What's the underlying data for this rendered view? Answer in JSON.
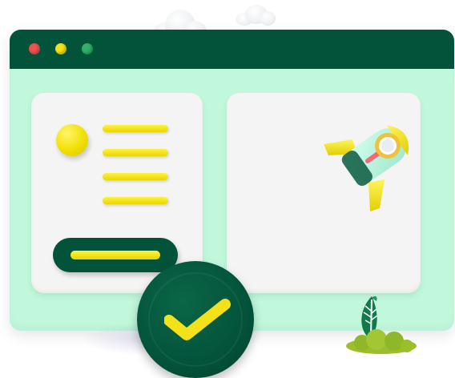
{
  "colors": {
    "window_bg": "#c1f8dc",
    "titlebar": "#03533a",
    "panel": "#f4f4f4",
    "accent_yellow": "#f3e21a",
    "dark_green": "#03533a",
    "dot_red": "#ef5350",
    "dot_yellow": "#f3e21a",
    "dot_green": "#2fb26a"
  },
  "window": {
    "controls": [
      "close-dot",
      "minimize-dot",
      "maximize-dot"
    ]
  },
  "left_panel": {
    "avatar_icon": "avatar-circle",
    "text_lines": 4,
    "button_icon": "placeholder-bar"
  },
  "right_panel": {
    "illustration": "rocket-icon"
  },
  "badge": {
    "icon": "checkmark-icon"
  },
  "decor": [
    "cloud-icon",
    "cloud-icon",
    "plant-icon"
  ]
}
